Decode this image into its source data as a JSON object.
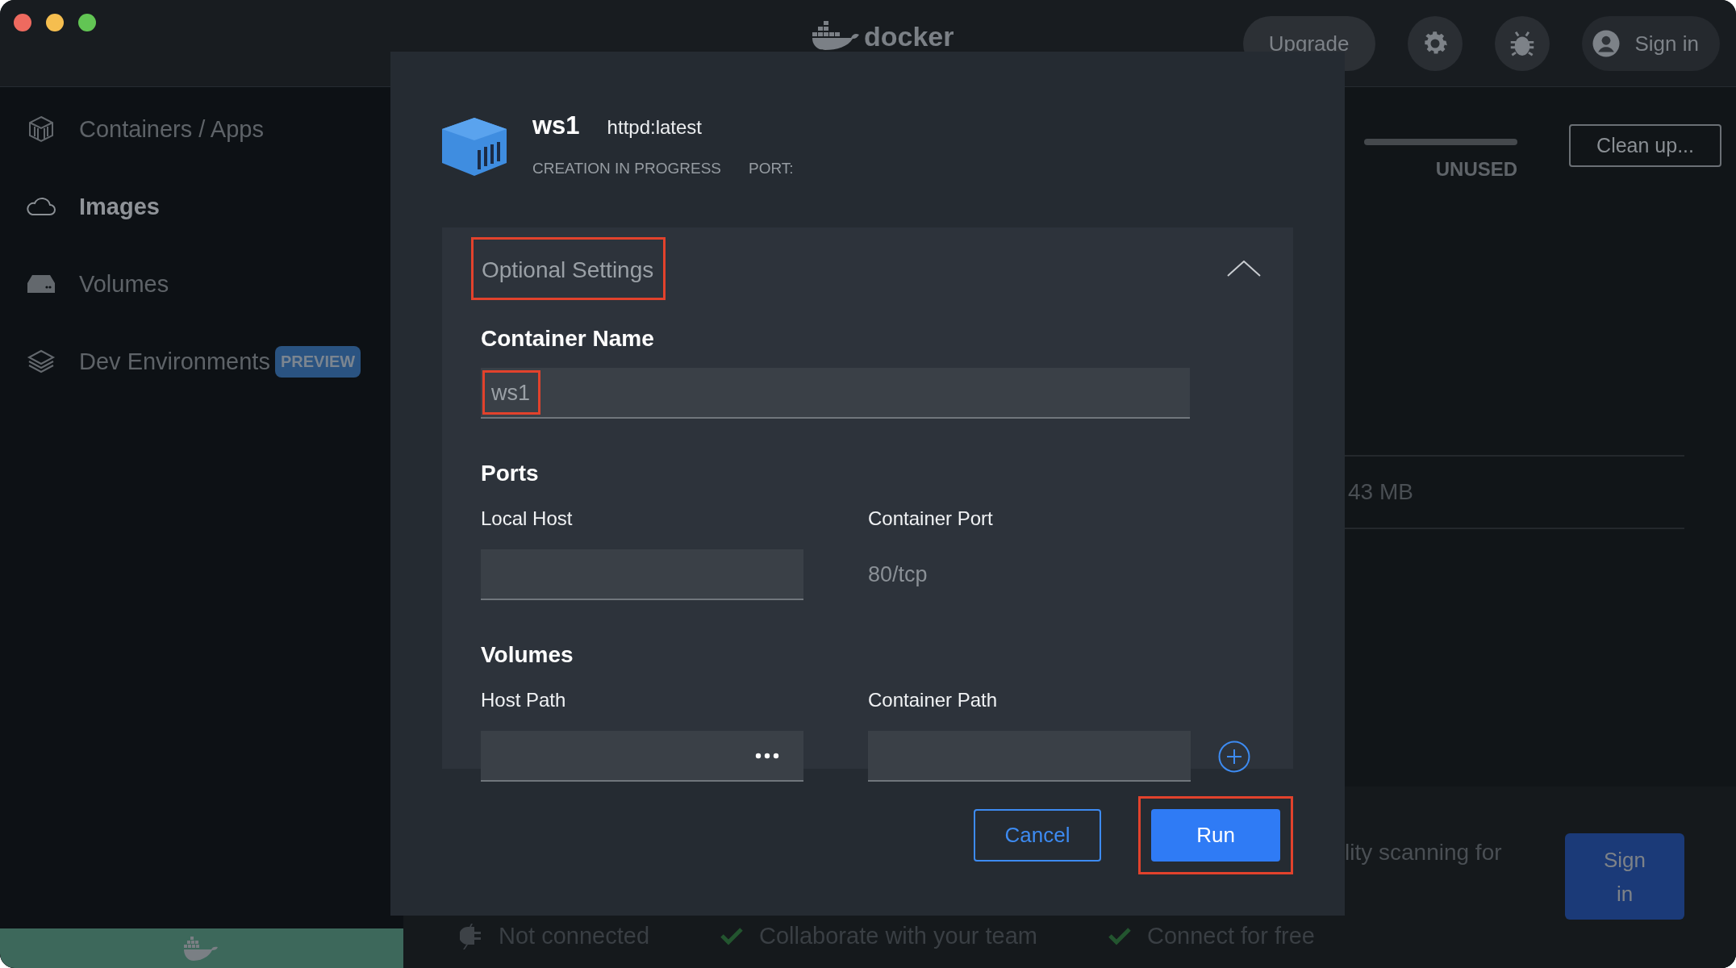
{
  "title_bar": {
    "logo_text": "docker",
    "upgrade_button": "Upgrade",
    "sign_in_button": "Sign in"
  },
  "sidebar": {
    "items": [
      {
        "kind": "containers",
        "label": "Containers / Apps",
        "selected": false
      },
      {
        "kind": "images",
        "label": "Images",
        "selected": true
      },
      {
        "kind": "volumes",
        "label": "Volumes",
        "selected": false
      },
      {
        "kind": "dev",
        "label": "Dev Environments",
        "badge": "PREVIEW",
        "selected": false
      }
    ]
  },
  "background": {
    "usage_label": "UNUSED",
    "cleanup_button": "Clean up...",
    "size": "43 MB",
    "banner_text": "lity scanning for",
    "banner_button": "Sign in",
    "status_items": [
      {
        "kind": "disconnected",
        "text": "Not connected"
      },
      {
        "kind": "check",
        "text": "Collaborate with your team"
      },
      {
        "kind": "check",
        "text": "Connect for free"
      }
    ]
  },
  "dialog": {
    "name": "ws1",
    "image": "httpd:latest",
    "status": "CREATION IN PROGRESS",
    "port_label": "PORT:",
    "optional_settings": {
      "title": "Optional Settings",
      "title_highlighted": true,
      "expanded": true,
      "container_name": {
        "label": "Container Name",
        "value": "ws1",
        "value_highlighted": true
      },
      "ports": {
        "title": "Ports",
        "local_host_label": "Local Host",
        "container_port_label": "Container Port",
        "container_port": "80/tcp"
      },
      "volumes": {
        "title": "Volumes",
        "host_path_label": "Host Path",
        "container_path_label": "Container Path"
      }
    },
    "buttons": [
      {
        "kind": "secondary",
        "label": "Cancel",
        "highlighted": false
      },
      {
        "kind": "primary",
        "label": "Run",
        "highlighted": true
      }
    ]
  }
}
